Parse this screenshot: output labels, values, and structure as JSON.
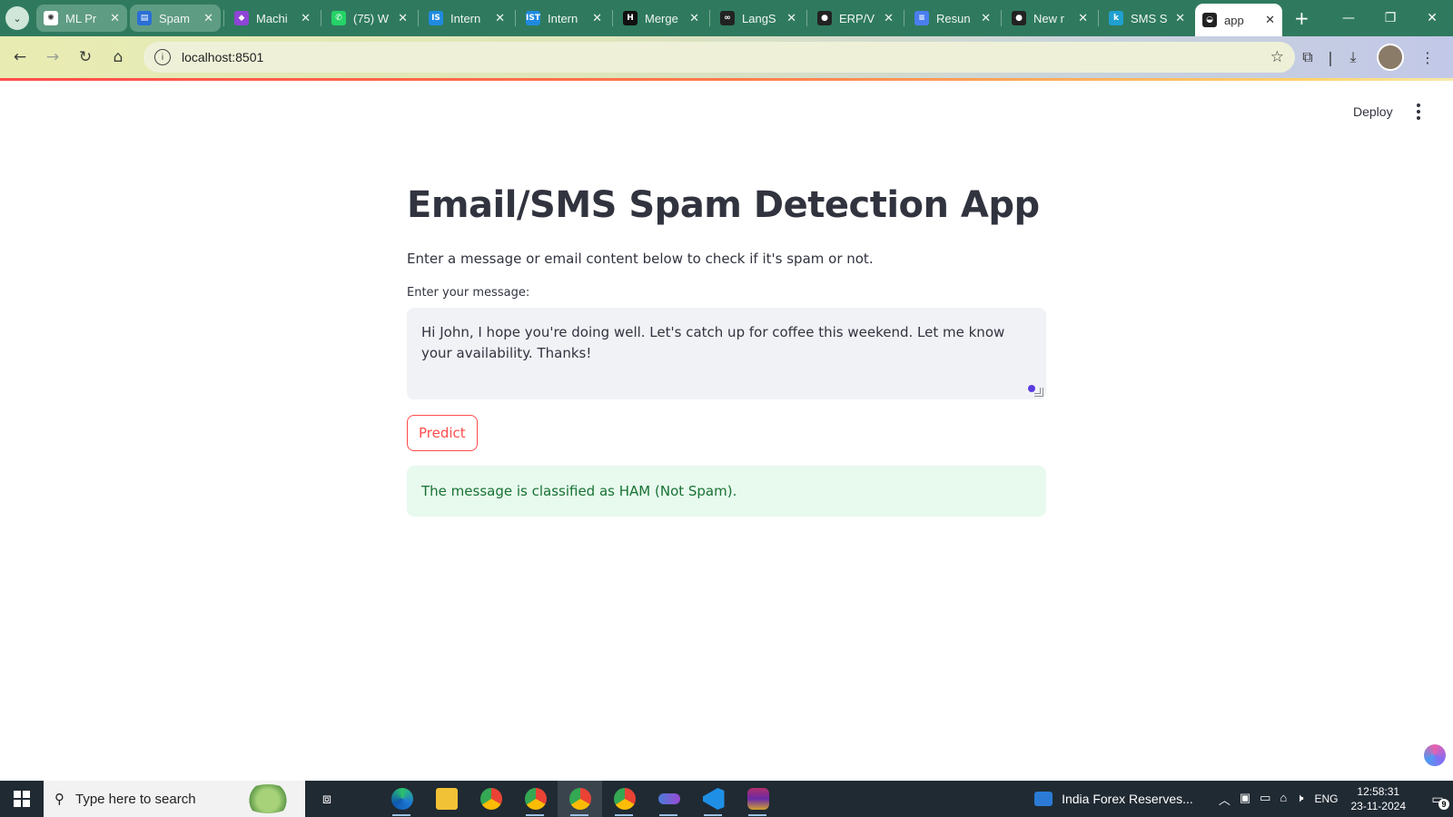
{
  "browser": {
    "tabs": [
      {
        "label": "ML Pr",
        "favicon_color": "#ffffff",
        "favicon_glyph": "✺"
      },
      {
        "label": "Spam",
        "favicon_color": "#2a6fd6",
        "favicon_glyph": "▤"
      },
      {
        "label": "Machi",
        "favicon_color": "#8e44d6",
        "favicon_glyph": "◆"
      },
      {
        "label": "(75) W",
        "favicon_color": "#25d366",
        "favicon_glyph": "✆"
      },
      {
        "label": "Intern",
        "favicon_color": "#1f8ae0",
        "favicon_glyph": "IS"
      },
      {
        "label": "Intern",
        "favicon_color": "#1f8ae0",
        "favicon_glyph": "IST"
      },
      {
        "label": "Merge",
        "favicon_color": "#111111",
        "favicon_glyph": "H"
      },
      {
        "label": "LangS",
        "favicon_color": "#222222",
        "favicon_glyph": "∞"
      },
      {
        "label": "ERP/V",
        "favicon_color": "#222222",
        "favicon_glyph": "●"
      },
      {
        "label": "Resun",
        "favicon_color": "#4a7ef0",
        "favicon_glyph": "≡"
      },
      {
        "label": "New r",
        "favicon_color": "#222222",
        "favicon_glyph": "●"
      },
      {
        "label": "SMS S",
        "favicon_color": "#20a0d0",
        "favicon_glyph": "k"
      },
      {
        "label": "app",
        "favicon_color": "#222222",
        "favicon_glyph": "◒"
      }
    ],
    "address": "localhost:8501"
  },
  "app": {
    "deploy_label": "Deploy",
    "title": "Email/SMS Spam Detection App",
    "subtitle": "Enter a message or email content below to check if it's spam or not.",
    "input_label": "Enter your message:",
    "input_value": "Hi John, I hope you're doing well. Let's catch up for coffee this weekend. Let me know your availability. Thanks!",
    "predict_label": "Predict",
    "result": "The message is classified as HAM (Not Spam).",
    "colors": {
      "primary": "#ff4b4b",
      "success_bg": "#e8f9ee",
      "success_text": "#177233"
    }
  },
  "taskbar": {
    "search_placeholder": "Type here to search",
    "news": "India Forex Reserves...",
    "lang": "ENG",
    "time": "12:58:31",
    "date": "23-11-2024",
    "notifications": "9"
  }
}
